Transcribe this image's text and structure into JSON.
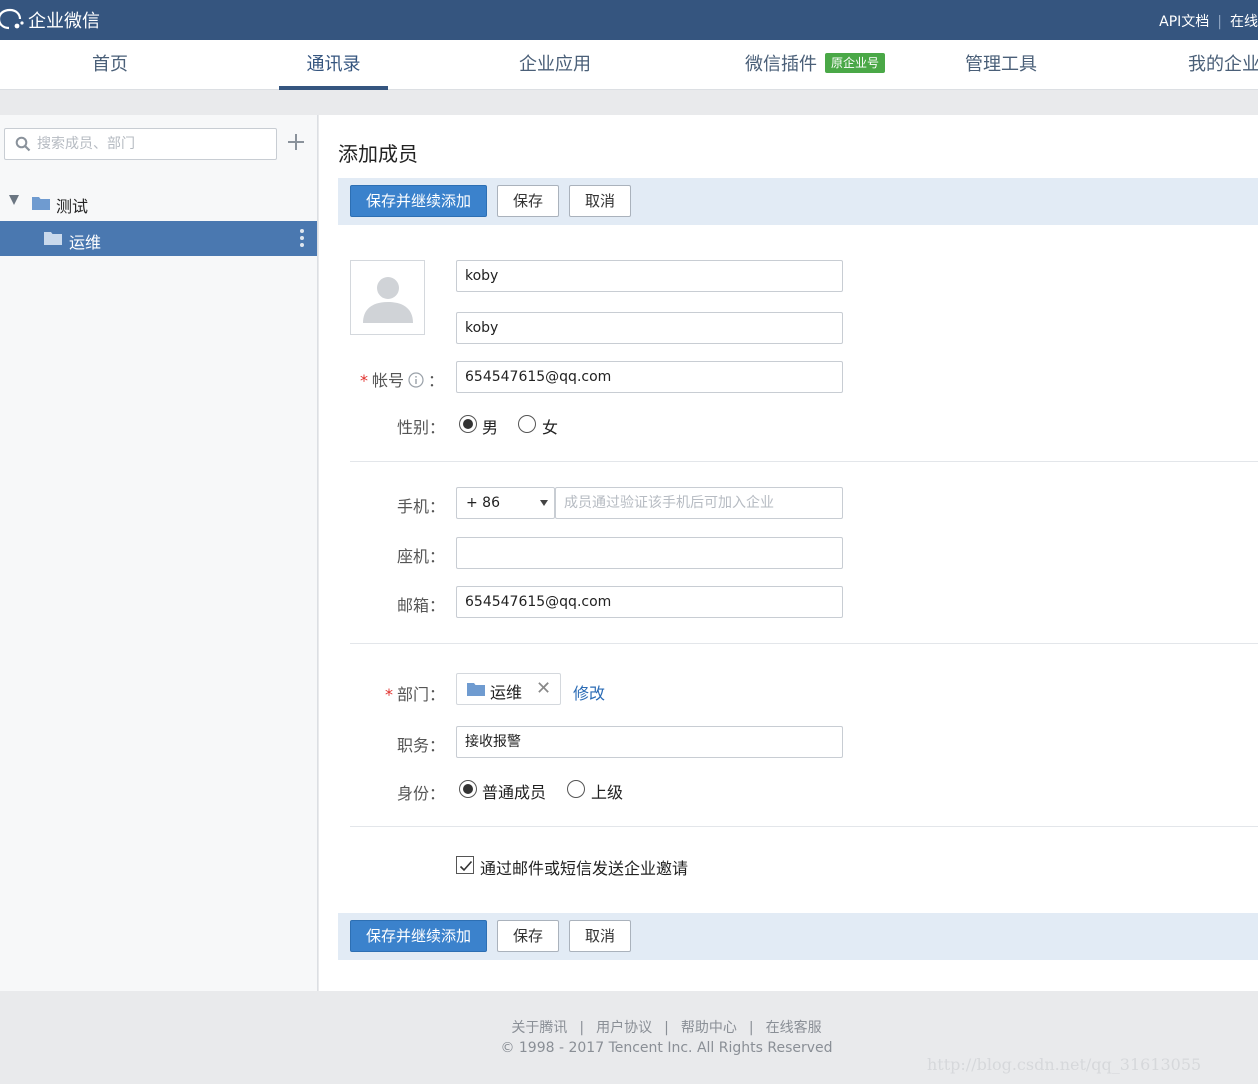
{
  "topbar": {
    "logo_text": "企业微信",
    "links": [
      "API文档",
      "在线"
    ]
  },
  "nav": {
    "items": [
      {
        "label": "首页"
      },
      {
        "label": "通讯录",
        "active": true
      },
      {
        "label": "企业应用"
      },
      {
        "label": "微信插件",
        "badge": "原企业号"
      },
      {
        "label": "管理工具"
      },
      {
        "label": "我的企业"
      }
    ]
  },
  "sidebar": {
    "search_placeholder": "搜索成员、部门",
    "tree": {
      "root_label": "测试",
      "child_label": "运维"
    }
  },
  "form": {
    "title": "添加成员",
    "buttons": {
      "save_continue": "保存并继续添加",
      "save": "保存",
      "cancel": "取消"
    },
    "name": "koby",
    "alias": "koby",
    "account_label": "帐号",
    "account_value": "654547615@qq.com",
    "gender_label": "性别：",
    "gender_options": [
      "男",
      "女"
    ],
    "gender_selected": "男",
    "phone_label": "手机：",
    "phone_prefix": "+ 86",
    "phone_placeholder": "成员通过验证该手机后可加入企业",
    "landline_label": "座机：",
    "landline_value": "",
    "email_label": "邮箱：",
    "email_value": "654547615@qq.com",
    "dept_label": "部门：",
    "dept_value": "运维",
    "dept_edit": "修改",
    "title_label": "职务：",
    "title_value": "接收报警",
    "role_label": "身份：",
    "role_options": [
      "普通成员",
      "上级"
    ],
    "role_selected": "普通成员",
    "invite_label": "通过邮件或短信发送企业邀请",
    "invite_checked": true
  },
  "footer": {
    "links": [
      "关于腾讯",
      "用户协议",
      "帮助中心",
      "在线客服"
    ],
    "copyright": "© 1998 - 2017 Tencent Inc. All Rights Reserved",
    "watermark": "http://blog.csdn.net/qq_31613055"
  },
  "colors": {
    "topbar": "#35557f",
    "primary_button": "#3b82cc",
    "selected_tree": "#4a78b0",
    "badge": "#4aa847",
    "required": "#e0302c"
  }
}
